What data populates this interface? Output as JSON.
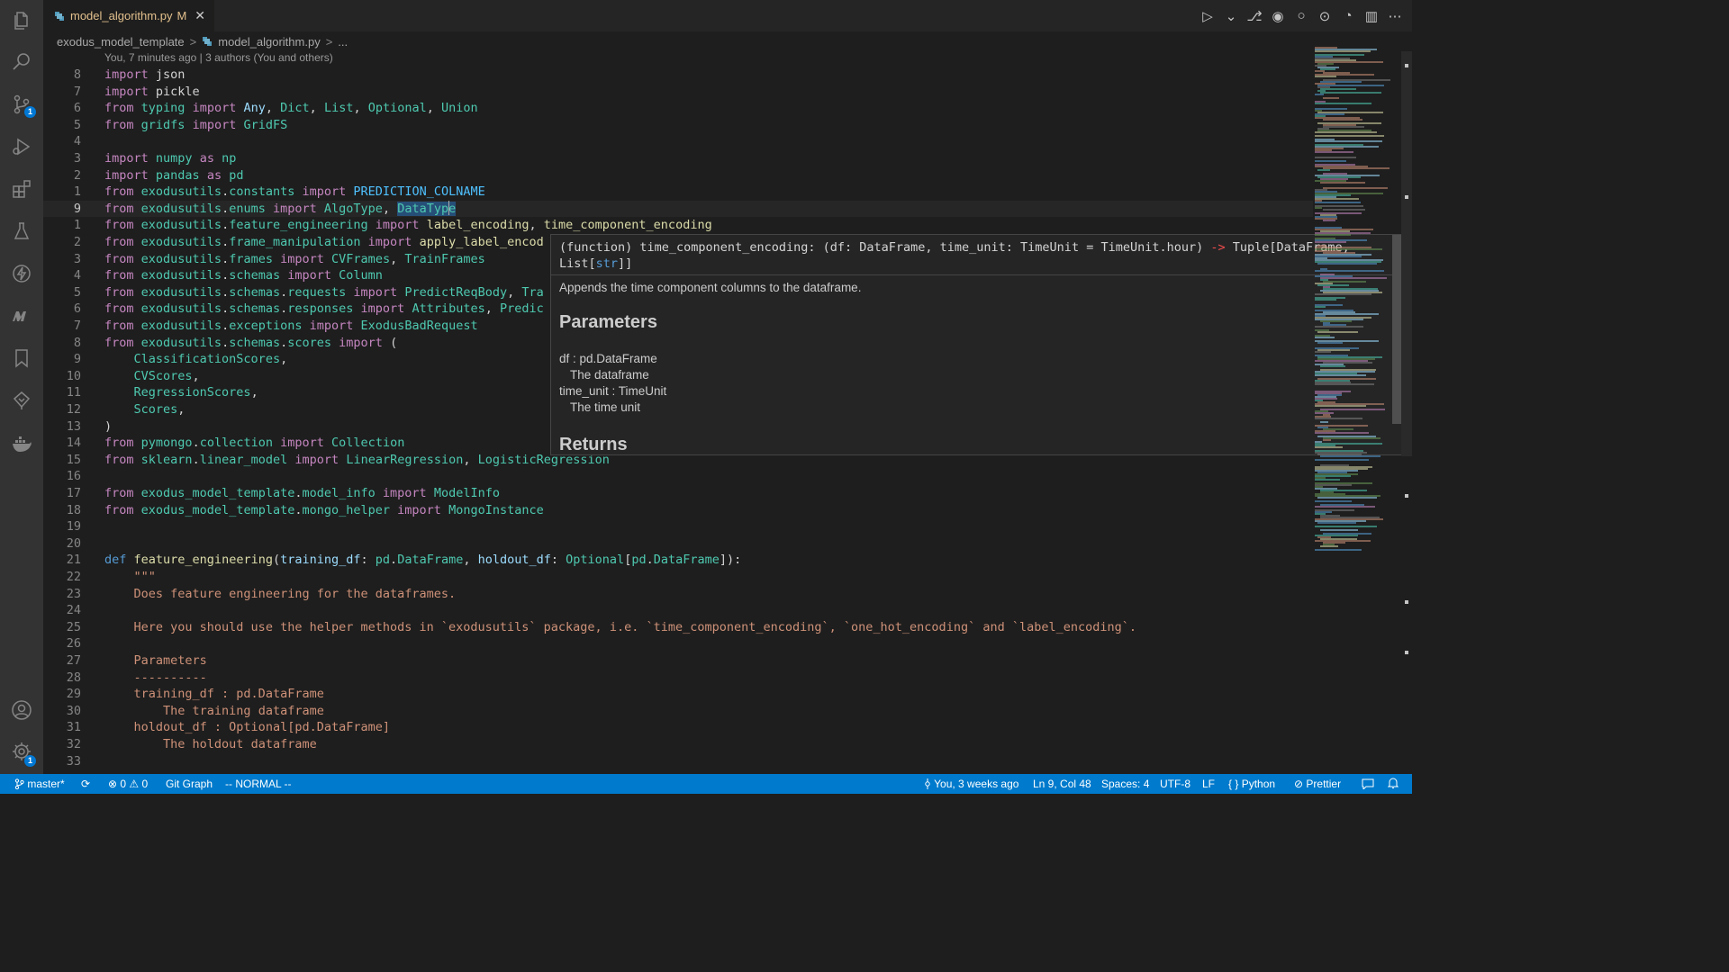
{
  "tab": {
    "filename": "model_algorithm.py",
    "modified": "M",
    "close": "✕"
  },
  "editor_actions": [
    "▷",
    "⌄",
    "⎇",
    "◉",
    "○",
    "⊙",
    "◔",
    "▥",
    "⋯"
  ],
  "breadcrumb": {
    "folder": "exodus_model_template",
    "file": "model_algorithm.py",
    "more": "...",
    "sep": ">"
  },
  "blame": "You, 7 minutes ago | 3 authors (You and others)",
  "activity_badges": {
    "scm": "1",
    "settings": "1"
  },
  "code_lines": [
    {
      "n": "8",
      "t": [
        [
          "kw",
          "import"
        ],
        [
          "p",
          " json"
        ]
      ]
    },
    {
      "n": "7",
      "t": [
        [
          "kw",
          "import"
        ],
        [
          "p",
          " pickle"
        ]
      ]
    },
    {
      "n": "6",
      "t": [
        [
          "kw",
          "from"
        ],
        [
          "p",
          " "
        ],
        [
          "cls",
          "typing"
        ],
        [
          "p",
          " "
        ],
        [
          "kw",
          "import"
        ],
        [
          "p",
          " "
        ],
        [
          "var",
          "Any"
        ],
        [
          "p",
          ", "
        ],
        [
          "cls",
          "Dict"
        ],
        [
          "p",
          ", "
        ],
        [
          "cls",
          "List"
        ],
        [
          "p",
          ", "
        ],
        [
          "cls",
          "Optional"
        ],
        [
          "p",
          ", "
        ],
        [
          "cls",
          "Union"
        ]
      ]
    },
    {
      "n": "5",
      "t": [
        [
          "kw",
          "from"
        ],
        [
          "p",
          " "
        ],
        [
          "cls",
          "gridfs"
        ],
        [
          "p",
          " "
        ],
        [
          "kw",
          "import"
        ],
        [
          "p",
          " "
        ],
        [
          "cls",
          "GridFS"
        ]
      ]
    },
    {
      "n": "4",
      "t": []
    },
    {
      "n": "3",
      "t": [
        [
          "kw",
          "import"
        ],
        [
          "p",
          " "
        ],
        [
          "cls",
          "numpy"
        ],
        [
          "p",
          " "
        ],
        [
          "kw",
          "as"
        ],
        [
          "p",
          " "
        ],
        [
          "cls",
          "np"
        ]
      ]
    },
    {
      "n": "2",
      "t": [
        [
          "kw",
          "import"
        ],
        [
          "p",
          " "
        ],
        [
          "cls",
          "pandas"
        ],
        [
          "p",
          " "
        ],
        [
          "kw",
          "as"
        ],
        [
          "p",
          " "
        ],
        [
          "cls",
          "pd"
        ]
      ]
    },
    {
      "n": "1",
      "t": [
        [
          "kw",
          "from"
        ],
        [
          "p",
          " "
        ],
        [
          "cls",
          "exodusutils"
        ],
        [
          "p",
          "."
        ],
        [
          "cls",
          "constants"
        ],
        [
          "p",
          " "
        ],
        [
          "kw",
          "import"
        ],
        [
          "p",
          " "
        ],
        [
          "const",
          "PREDICTION_COLNAME"
        ]
      ]
    },
    {
      "n": "9",
      "current": true,
      "t": [
        [
          "kw",
          "from"
        ],
        [
          "p",
          " "
        ],
        [
          "cls",
          "exodusutils"
        ],
        [
          "p",
          "."
        ],
        [
          "cls",
          "enums"
        ],
        [
          "p",
          " "
        ],
        [
          "kw",
          "import"
        ],
        [
          "p",
          " "
        ],
        [
          "cls",
          "AlgoType"
        ],
        [
          "p",
          ", "
        ],
        [
          "hl",
          "DataType"
        ]
      ]
    },
    {
      "n": "1",
      "t": [
        [
          "kw",
          "from"
        ],
        [
          "p",
          " "
        ],
        [
          "cls",
          "exodusutils"
        ],
        [
          "p",
          "."
        ],
        [
          "cls",
          "feature_engineering"
        ],
        [
          "p",
          " "
        ],
        [
          "kw",
          "import"
        ],
        [
          "p",
          " "
        ],
        [
          "fn",
          "label_encoding"
        ],
        [
          "p",
          ", "
        ],
        [
          "fn",
          "time_component_encoding"
        ]
      ]
    },
    {
      "n": "2",
      "t": [
        [
          "kw",
          "from"
        ],
        [
          "p",
          " "
        ],
        [
          "cls",
          "exodusutils"
        ],
        [
          "p",
          "."
        ],
        [
          "cls",
          "frame_manipulation"
        ],
        [
          "p",
          " "
        ],
        [
          "kw",
          "import"
        ],
        [
          "p",
          " "
        ],
        [
          "fn",
          "apply_label_encod"
        ]
      ]
    },
    {
      "n": "3",
      "t": [
        [
          "kw",
          "from"
        ],
        [
          "p",
          " "
        ],
        [
          "cls",
          "exodusutils"
        ],
        [
          "p",
          "."
        ],
        [
          "cls",
          "frames"
        ],
        [
          "p",
          " "
        ],
        [
          "kw",
          "import"
        ],
        [
          "p",
          " "
        ],
        [
          "cls",
          "CVFrames"
        ],
        [
          "p",
          ", "
        ],
        [
          "cls",
          "TrainFrames"
        ]
      ]
    },
    {
      "n": "4",
      "t": [
        [
          "kw",
          "from"
        ],
        [
          "p",
          " "
        ],
        [
          "cls",
          "exodusutils"
        ],
        [
          "p",
          "."
        ],
        [
          "cls",
          "schemas"
        ],
        [
          "p",
          " "
        ],
        [
          "kw",
          "import"
        ],
        [
          "p",
          " "
        ],
        [
          "cls",
          "Column"
        ]
      ]
    },
    {
      "n": "5",
      "t": [
        [
          "kw",
          "from"
        ],
        [
          "p",
          " "
        ],
        [
          "cls",
          "exodusutils"
        ],
        [
          "p",
          "."
        ],
        [
          "cls",
          "schemas"
        ],
        [
          "p",
          "."
        ],
        [
          "cls",
          "requests"
        ],
        [
          "p",
          " "
        ],
        [
          "kw",
          "import"
        ],
        [
          "p",
          " "
        ],
        [
          "cls",
          "PredictReqBody"
        ],
        [
          "p",
          ", "
        ],
        [
          "cls",
          "Tra"
        ]
      ]
    },
    {
      "n": "6",
      "t": [
        [
          "kw",
          "from"
        ],
        [
          "p",
          " "
        ],
        [
          "cls",
          "exodusutils"
        ],
        [
          "p",
          "."
        ],
        [
          "cls",
          "schemas"
        ],
        [
          "p",
          "."
        ],
        [
          "cls",
          "responses"
        ],
        [
          "p",
          " "
        ],
        [
          "kw",
          "import"
        ],
        [
          "p",
          " "
        ],
        [
          "cls",
          "Attributes"
        ],
        [
          "p",
          ", "
        ],
        [
          "cls",
          "Predic"
        ]
      ]
    },
    {
      "n": "7",
      "t": [
        [
          "kw",
          "from"
        ],
        [
          "p",
          " "
        ],
        [
          "cls",
          "exodusutils"
        ],
        [
          "p",
          "."
        ],
        [
          "cls",
          "exceptions"
        ],
        [
          "p",
          " "
        ],
        [
          "kw",
          "import"
        ],
        [
          "p",
          " "
        ],
        [
          "cls",
          "ExodusBadRequest"
        ]
      ]
    },
    {
      "n": "8",
      "t": [
        [
          "kw",
          "from"
        ],
        [
          "p",
          " "
        ],
        [
          "cls",
          "exodusutils"
        ],
        [
          "p",
          "."
        ],
        [
          "cls",
          "schemas"
        ],
        [
          "p",
          "."
        ],
        [
          "cls",
          "scores"
        ],
        [
          "p",
          " "
        ],
        [
          "kw",
          "import"
        ],
        [
          "p",
          " ("
        ]
      ]
    },
    {
      "n": "9",
      "t": [
        [
          "p",
          "    "
        ],
        [
          "cls",
          "ClassificationScores"
        ],
        [
          "p",
          ","
        ]
      ]
    },
    {
      "n": "10",
      "t": [
        [
          "p",
          "    "
        ],
        [
          "cls",
          "CVScores"
        ],
        [
          "p",
          ","
        ]
      ]
    },
    {
      "n": "11",
      "t": [
        [
          "p",
          "    "
        ],
        [
          "cls",
          "RegressionScores"
        ],
        [
          "p",
          ","
        ]
      ]
    },
    {
      "n": "12",
      "t": [
        [
          "p",
          "    "
        ],
        [
          "cls",
          "Scores"
        ],
        [
          "p",
          ","
        ]
      ]
    },
    {
      "n": "13",
      "t": [
        [
          "p",
          ")"
        ]
      ]
    },
    {
      "n": "14",
      "t": [
        [
          "kw",
          "from"
        ],
        [
          "p",
          " "
        ],
        [
          "cls",
          "pymongo"
        ],
        [
          "p",
          "."
        ],
        [
          "cls",
          "collection"
        ],
        [
          "p",
          " "
        ],
        [
          "kw",
          "import"
        ],
        [
          "p",
          " "
        ],
        [
          "cls",
          "Collection"
        ]
      ]
    },
    {
      "n": "15",
      "t": [
        [
          "kw",
          "from"
        ],
        [
          "p",
          " "
        ],
        [
          "cls",
          "sklearn"
        ],
        [
          "p",
          "."
        ],
        [
          "cls",
          "linear_model"
        ],
        [
          "p",
          " "
        ],
        [
          "kw",
          "import"
        ],
        [
          "p",
          " "
        ],
        [
          "cls",
          "LinearRegression"
        ],
        [
          "p",
          ", "
        ],
        [
          "cls",
          "LogisticRegression"
        ]
      ]
    },
    {
      "n": "16",
      "t": []
    },
    {
      "n": "17",
      "t": [
        [
          "kw",
          "from"
        ],
        [
          "p",
          " "
        ],
        [
          "cls",
          "exodus_model_template"
        ],
        [
          "p",
          "."
        ],
        [
          "cls",
          "model_info"
        ],
        [
          "p",
          " "
        ],
        [
          "kw",
          "import"
        ],
        [
          "p",
          " "
        ],
        [
          "cls",
          "ModelInfo"
        ]
      ]
    },
    {
      "n": "18",
      "t": [
        [
          "kw",
          "from"
        ],
        [
          "p",
          " "
        ],
        [
          "cls",
          "exodus_model_template"
        ],
        [
          "p",
          "."
        ],
        [
          "cls",
          "mongo_helper"
        ],
        [
          "p",
          " "
        ],
        [
          "kw",
          "import"
        ],
        [
          "p",
          " "
        ],
        [
          "cls",
          "MongoInstance"
        ]
      ]
    },
    {
      "n": "19",
      "t": []
    },
    {
      "n": "20",
      "t": []
    },
    {
      "n": "21",
      "t": [
        [
          "def",
          "def"
        ],
        [
          "p",
          " "
        ],
        [
          "fn",
          "feature_engineering"
        ],
        [
          "p",
          "("
        ],
        [
          "var",
          "training_df"
        ],
        [
          "p",
          ": "
        ],
        [
          "cls",
          "pd"
        ],
        [
          "p",
          "."
        ],
        [
          "cls",
          "DataFrame"
        ],
        [
          "p",
          ", "
        ],
        [
          "var",
          "holdout_df"
        ],
        [
          "p",
          ": "
        ],
        [
          "cls",
          "Optional"
        ],
        [
          "p",
          "["
        ],
        [
          "cls",
          "pd"
        ],
        [
          "p",
          "."
        ],
        [
          "cls",
          "DataFrame"
        ],
        [
          "p",
          "]):"
        ]
      ]
    },
    {
      "n": "22",
      "t": [
        [
          "p",
          "    "
        ],
        [
          "str",
          "\"\"\""
        ]
      ]
    },
    {
      "n": "23",
      "t": [
        [
          "p",
          "    "
        ],
        [
          "str",
          "Does feature engineering for the dataframes."
        ]
      ]
    },
    {
      "n": "24",
      "t": []
    },
    {
      "n": "25",
      "t": [
        [
          "p",
          "    "
        ],
        [
          "str",
          "Here you should use the helper methods in `exodusutils` package, i.e. `time_component_encoding`, `one_hot_encoding` and `label_encoding`."
        ]
      ]
    },
    {
      "n": "26",
      "t": []
    },
    {
      "n": "27",
      "t": [
        [
          "p",
          "    "
        ],
        [
          "str",
          "Parameters"
        ]
      ]
    },
    {
      "n": "28",
      "t": [
        [
          "p",
          "    "
        ],
        [
          "str",
          "----------"
        ]
      ]
    },
    {
      "n": "29",
      "t": [
        [
          "p",
          "    "
        ],
        [
          "str",
          "training_df : pd.DataFrame"
        ]
      ]
    },
    {
      "n": "30",
      "t": [
        [
          "p",
          "        "
        ],
        [
          "str",
          "The training dataframe"
        ]
      ]
    },
    {
      "n": "31",
      "t": [
        [
          "p",
          "    "
        ],
        [
          "str",
          "holdout_df : Optional[pd.DataFrame]"
        ]
      ]
    },
    {
      "n": "32",
      "t": [
        [
          "p",
          "        "
        ],
        [
          "str",
          "The holdout dataframe"
        ]
      ]
    },
    {
      "n": "33",
      "t": []
    }
  ],
  "hover": {
    "signature": [
      [
        "p",
        "(function) time_component_encoding: (df: DataFrame, time_unit: TimeUnit = TimeUnit.hour) "
      ],
      [
        "kw",
        "->"
      ],
      [
        "p",
        " Tuple[DataFrame,"
      ],
      [
        "br",
        ""
      ],
      [
        "p",
        "List["
      ],
      [
        "def",
        "str"
      ],
      [
        "p",
        "]]"
      ]
    ],
    "description": "Appends the time component columns to the dataframe.",
    "params_heading": "Parameters",
    "param1_name": "df : pd.DataFrame",
    "param1_desc": "The dataframe",
    "param2_name": "time_unit : TimeUnit",
    "param2_desc": "The time unit",
    "returns_heading": "Returns"
  },
  "status": {
    "branch": "master*",
    "sync": "⟳",
    "problems": "⊗ 0 ⚠ 0",
    "git_graph": "Git Graph",
    "vim_mode": "-- NORMAL --",
    "blame": "You, 3 weeks ago",
    "cursor": "Ln 9, Col 48",
    "spaces": "Spaces: 4",
    "encoding": "UTF-8",
    "eol": "LF",
    "language": "Python",
    "formatter": "Prettier"
  },
  "colors": {
    "keyword": "#c586c0",
    "function": "#dcdcaa",
    "class": "#4ec9b0",
    "status_bar": "#007acc"
  }
}
